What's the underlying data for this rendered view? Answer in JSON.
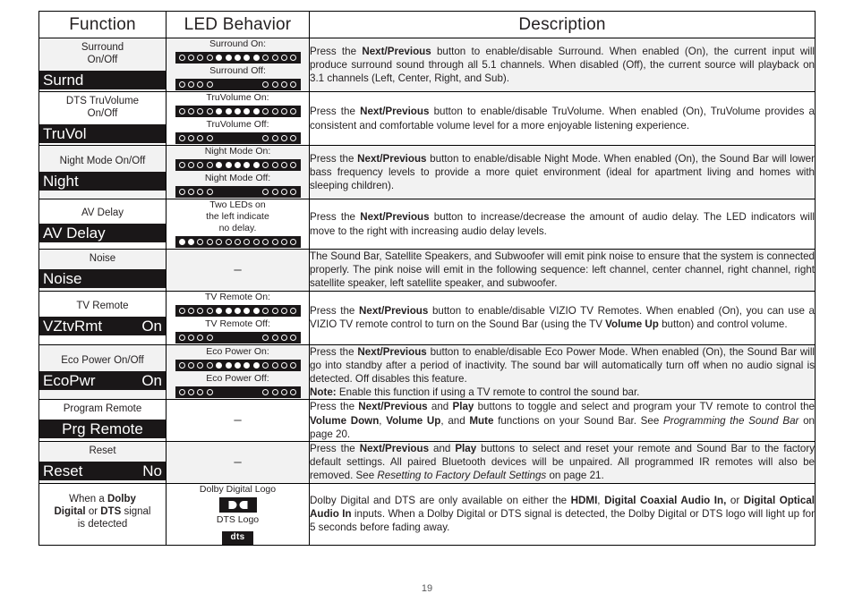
{
  "page": {
    "number": "19"
  },
  "table": {
    "headers": [
      "Function",
      "LED Behavior",
      "Description"
    ],
    "rows": [
      {
        "function": {
          "title_html": "Surround<br>On/Off",
          "lcd_left": "Surnd",
          "lcd_right": ""
        },
        "led": {
          "type": "two-states",
          "on_caption": "Surround On:",
          "off_caption": "Surround Off:",
          "on_pattern": [
            "off",
            "off",
            "off",
            "off",
            "on",
            "on",
            "on",
            "on",
            "on",
            "off",
            "off",
            "off",
            "off"
          ],
          "off_pattern": [
            "off",
            "off",
            "off",
            "off",
            "gap",
            "gap",
            "gap",
            "gap",
            "gap",
            "off",
            "off",
            "off",
            "off"
          ]
        },
        "description_html": "Press the <b>Next/Previous</b> button to enable/disable Surround. When enabled (On), the current input will produce surround sound through all 5.1 channels. When disabled (Off), the current source will playback on 3.1 channels (Left, Center, Right, and Sub)."
      },
      {
        "function": {
          "title_html": "DTS TruVolume<br>On/Off",
          "lcd_left": "TruVol",
          "lcd_right": ""
        },
        "led": {
          "type": "two-states",
          "on_caption": "TruVolume On:",
          "off_caption": "TruVolume Off:",
          "on_pattern": [
            "off",
            "off",
            "off",
            "off",
            "on",
            "on",
            "on",
            "on",
            "on",
            "off",
            "off",
            "off",
            "off"
          ],
          "off_pattern": [
            "off",
            "off",
            "off",
            "off",
            "gap",
            "gap",
            "gap",
            "gap",
            "gap",
            "off",
            "off",
            "off",
            "off"
          ]
        },
        "description_html": "Press the <b>Next/Previous</b> button to enable/disable TruVolume. When enabled (On), TruVolume provides a consistent and comfortable volume level for a more enjoyable listening experience."
      },
      {
        "function": {
          "title_html": "Night Mode On/Off",
          "lcd_left": "Night",
          "lcd_right": ""
        },
        "led": {
          "type": "two-states",
          "on_caption": "Night Mode On:",
          "off_caption": "Night Mode Off:",
          "on_pattern": [
            "off",
            "off",
            "off",
            "off",
            "on",
            "on",
            "on",
            "on",
            "on",
            "off",
            "off",
            "off",
            "off"
          ],
          "off_pattern": [
            "off",
            "off",
            "off",
            "off",
            "gap",
            "gap",
            "gap",
            "gap",
            "gap",
            "off",
            "off",
            "off",
            "off"
          ]
        },
        "description_html": "Press the <b>Next/Previous</b> button to enable/disable Night Mode. When enabled (On), the Sound Bar will lower bass frequency levels to provide a more quiet environment (ideal for apartment living and homes with sleeping children)."
      },
      {
        "function": {
          "title_html": "AV Delay",
          "lcd_left": "AV Delay",
          "lcd_right": ""
        },
        "led": {
          "type": "note-then-bar",
          "note_html": "Two LEDs on<br>the left indicate<br>no delay.",
          "pattern": [
            "on",
            "on",
            "off",
            "off",
            "off",
            "off",
            "off",
            "off",
            "off",
            "off",
            "off",
            "off",
            "off"
          ]
        },
        "description_html": "Press the <b>Next/Previous</b> button to increase/decrease the amount of audio delay. The LED indicators will move to the right with increasing audio delay levels."
      },
      {
        "function": {
          "title_html": "Noise",
          "lcd_left": "Noise",
          "lcd_right": ""
        },
        "led": {
          "type": "dash",
          "dash": "–"
        },
        "description_html": "The Sound Bar, Satellite Speakers, and Subwoofer will emit pink noise to ensure that the system is connected properly. The pink noise will emit in the following sequence: left channel, center channel, right channel, right satellite speaker, left satellite speaker, and subwoofer."
      },
      {
        "function": {
          "title_html": "TV Remote",
          "lcd_left": "VZtvRmt",
          "lcd_right": "On"
        },
        "led": {
          "type": "two-states",
          "on_caption": "TV Remote On:",
          "off_caption": "TV Remote Off:",
          "on_pattern": [
            "off",
            "off",
            "off",
            "off",
            "on",
            "on",
            "on",
            "on",
            "on",
            "off",
            "off",
            "off",
            "off"
          ],
          "off_pattern": [
            "off",
            "off",
            "off",
            "off",
            "gap",
            "gap",
            "gap",
            "gap",
            "gap",
            "off",
            "off",
            "off",
            "off"
          ]
        },
        "description_html": "Press the <b>Next/Previous</b> button to enable/disable VIZIO TV Remotes. When enabled (On), you can use a VIZIO TV remote control to turn on the Sound Bar (using the TV <b>Volume Up</b> button) and control volume."
      },
      {
        "function": {
          "title_html": "Eco Power On/Off",
          "lcd_left": "EcoPwr",
          "lcd_right": "On"
        },
        "led": {
          "type": "two-states",
          "on_caption": "Eco Power On:",
          "off_caption": "Eco Power Off:",
          "on_pattern": [
            "off",
            "off",
            "off",
            "off",
            "on",
            "on",
            "on",
            "on",
            "on",
            "off",
            "off",
            "off",
            "off"
          ],
          "off_pattern": [
            "off",
            "off",
            "off",
            "off",
            "gap",
            "gap",
            "gap",
            "gap",
            "gap",
            "off",
            "off",
            "off",
            "off"
          ]
        },
        "description_html": "Press the <b>Next/Previous</b> button to enable/disable Eco Power Mode. When enabled (On), the Sound Bar will go into standby after a period of inactivity. The sound bar will automatically turn off when no audio signal is detected. Off disables this feature.<br><b>Note:</b> Enable this function if using a TV remote to control the sound bar."
      },
      {
        "function": {
          "title_html": "Program Remote",
          "lcd_left": "Prg Remote",
          "lcd_right": "",
          "lcd_center": true
        },
        "led": {
          "type": "dash",
          "dash": "–"
        },
        "description_html": "Press the <b>Next/Previous</b> and <b>Play</b> buttons to toggle and select and program your TV remote to control the <b>Volume Down</b>, <b>Volume Up</b>, and <b>Mute</b> functions on your Sound Bar. See <i>Programming the Sound Bar</i> on page 20."
      },
      {
        "function": {
          "title_html": "Reset",
          "lcd_left": "Reset",
          "lcd_right": "No"
        },
        "led": {
          "type": "dash",
          "dash": "–"
        },
        "description_html": "Press the <b>Next/Previous</b> and <b>Play</b> buttons to select and reset your remote and Sound Bar to the factory default settings. All paired Bluetooth devices will be unpaired. All programmed IR remotes will also be removed. See <i>Resetting to Factory Default Settings</i> on page 21."
      },
      {
        "function": {
          "title_html": "When a <b>Dolby<br>Digital</b> or <b>DTS</b> signal<br>is detected",
          "lcd_left": "",
          "lcd_right": "",
          "no_lcd": true
        },
        "led": {
          "type": "logos",
          "dolby_caption": "Dolby Digital Logo",
          "dts_caption": "DTS Logo",
          "dts_label": "dts"
        },
        "description_html": "Dolby Digital and DTS are only available on either the <b>HDMI</b>, <b>Digital Coaxial Audio In,</b> or <b>Digital Optical Audio In</b> inputs. When a Dolby Digital or DTS signal is detected, the Dolby Digital or DTS logo will light up for 5 seconds before fading away."
      }
    ]
  }
}
